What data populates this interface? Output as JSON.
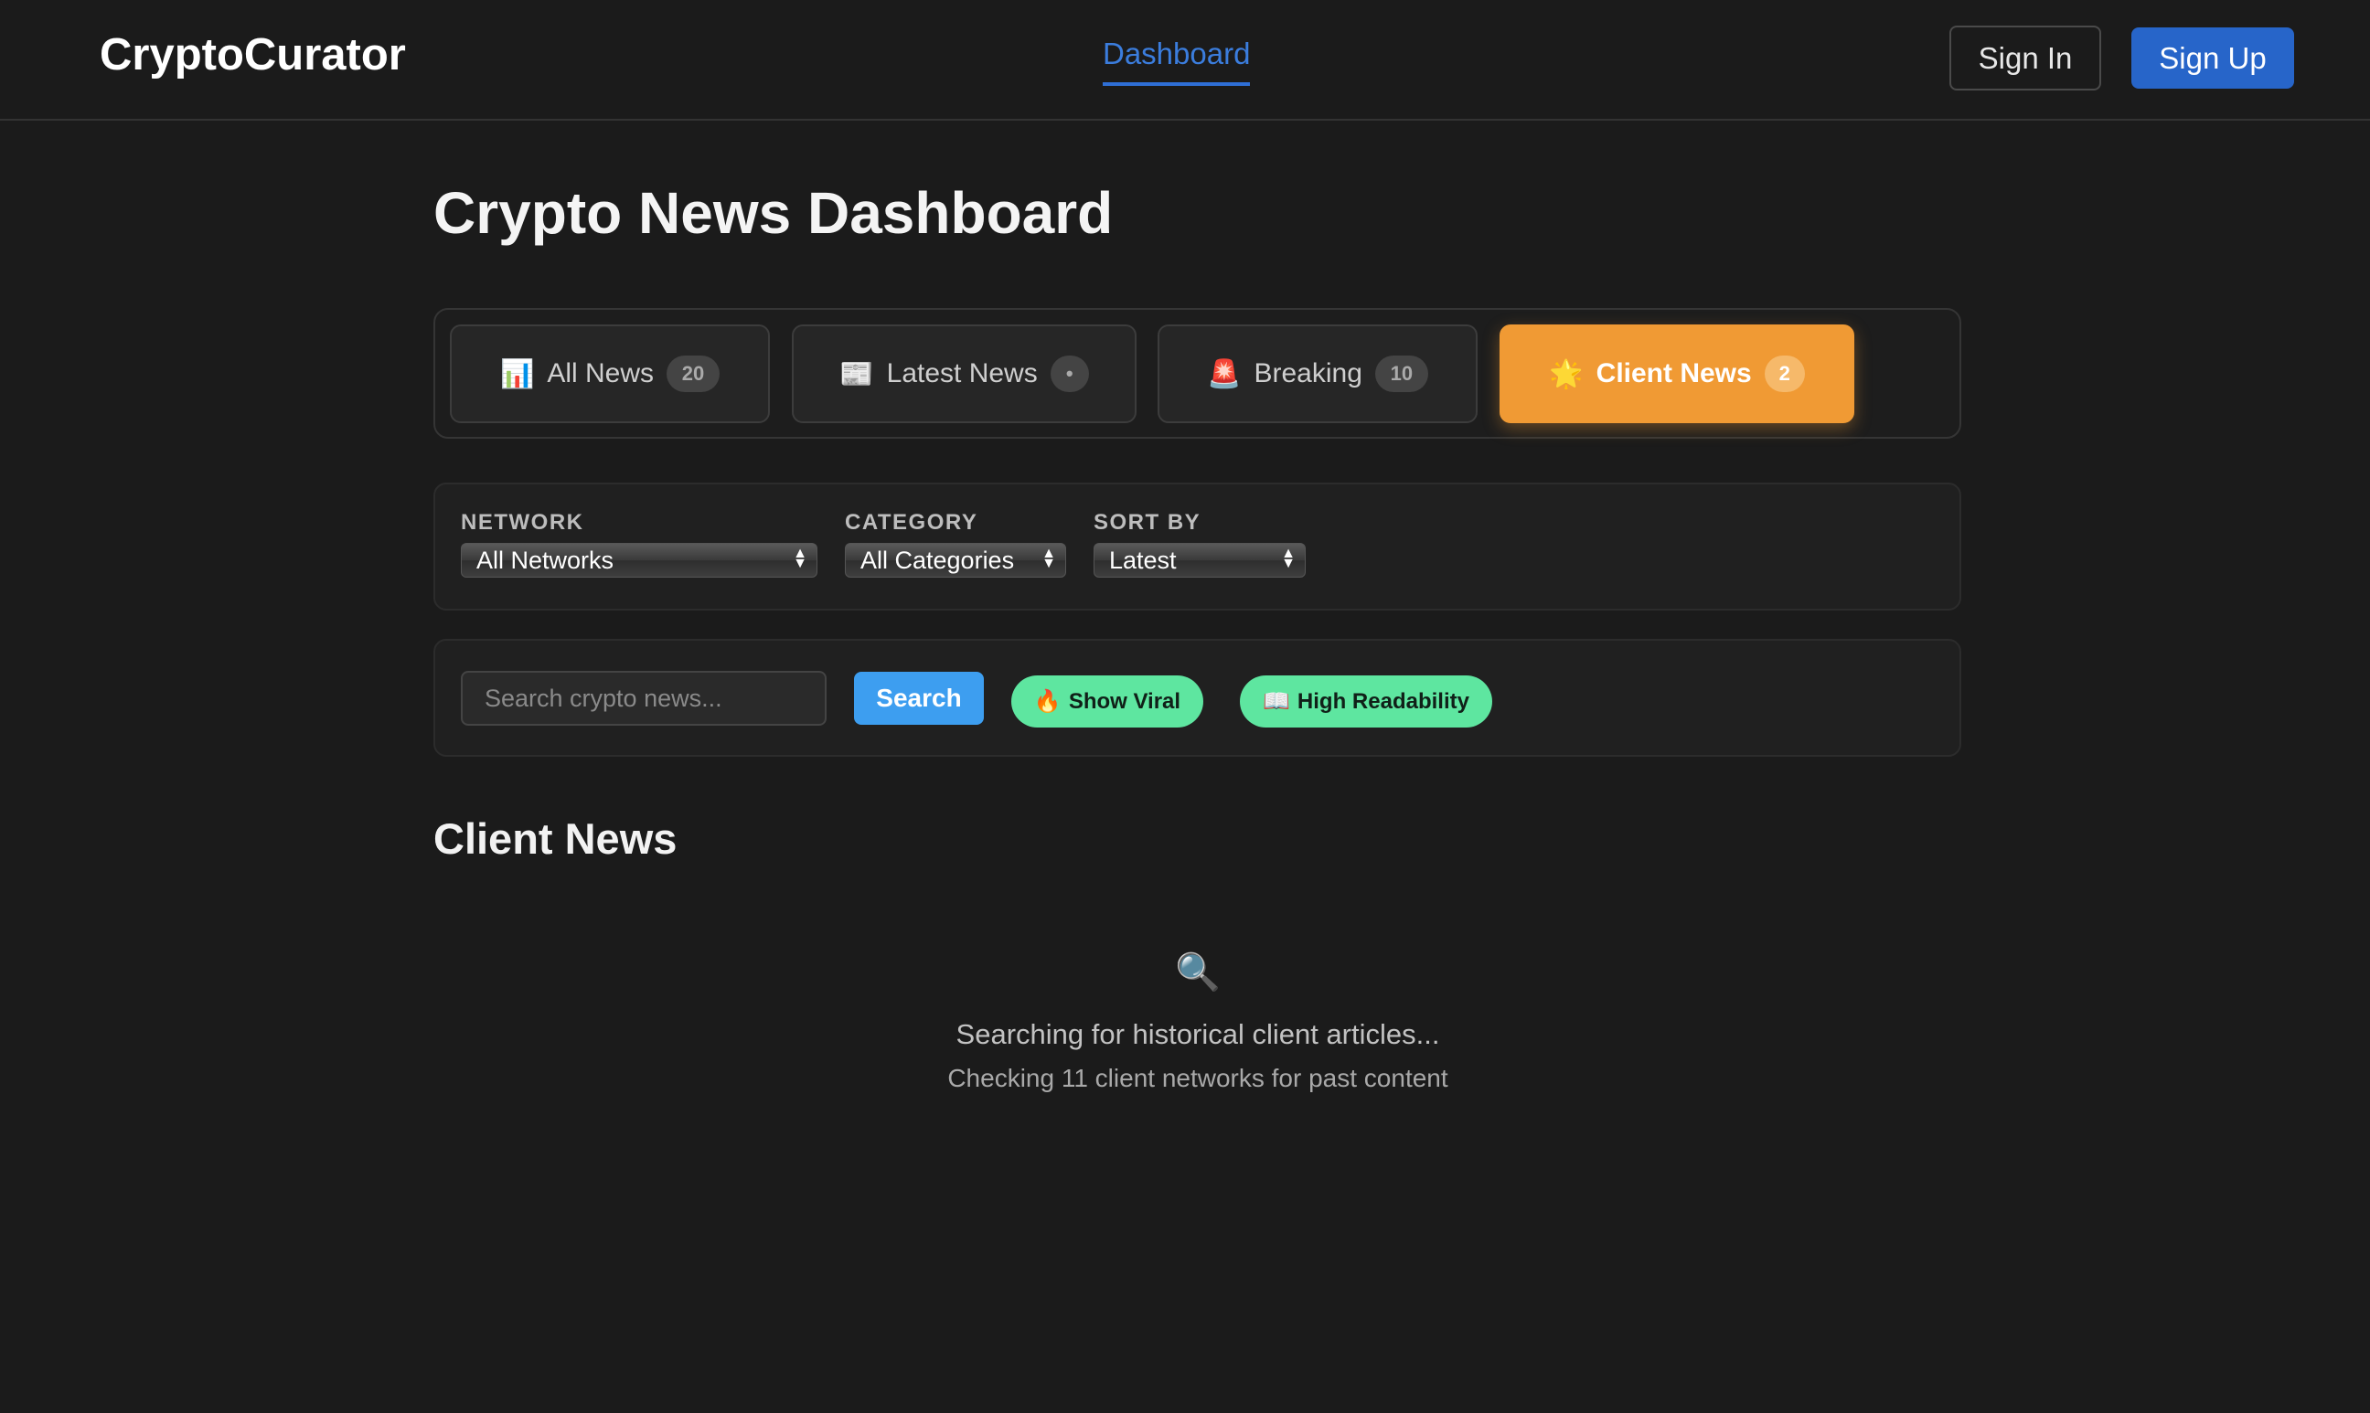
{
  "app": {
    "brand": "CryptoCurator",
    "nav": {
      "dashboard_label": "Dashboard"
    },
    "auth": {
      "signin_label": "Sign In",
      "signup_label": "Sign Up"
    }
  },
  "main": {
    "title": "Crypto News Dashboard",
    "tabs": [
      {
        "icon": "📊",
        "label": "All News",
        "count": "20",
        "active": false
      },
      {
        "icon": "📰",
        "label": "Latest News",
        "count": "•",
        "active": false
      },
      {
        "icon": "🚨",
        "label": "Breaking",
        "count": "10",
        "active": false
      },
      {
        "icon": "🌟",
        "label": "Client News",
        "count": "2",
        "active": true
      }
    ],
    "filters": {
      "network": {
        "label": "NETWORK",
        "selected": "All Networks"
      },
      "category": {
        "label": "CATEGORY",
        "selected": "All Categories"
      },
      "sort": {
        "label": "SORT BY",
        "selected": "Latest"
      }
    },
    "search": {
      "placeholder": "Search crypto news...",
      "button_label": "Search",
      "viral_icon": "🔥",
      "viral_label": "Show Viral",
      "readability_icon": "📖",
      "readability_label": "High Readability"
    },
    "section_title": "Client News",
    "empty_state": {
      "icon": "🔍",
      "title": "Searching for historical client articles...",
      "subtitle": "Checking 11 client networks for past content"
    }
  },
  "colors": {
    "background": "#1b1b1b",
    "accent_blue": "#2765c9",
    "active_tab": "#f09a34",
    "search_button": "#3d9ef0",
    "pill_green": "#5ee6a0"
  }
}
